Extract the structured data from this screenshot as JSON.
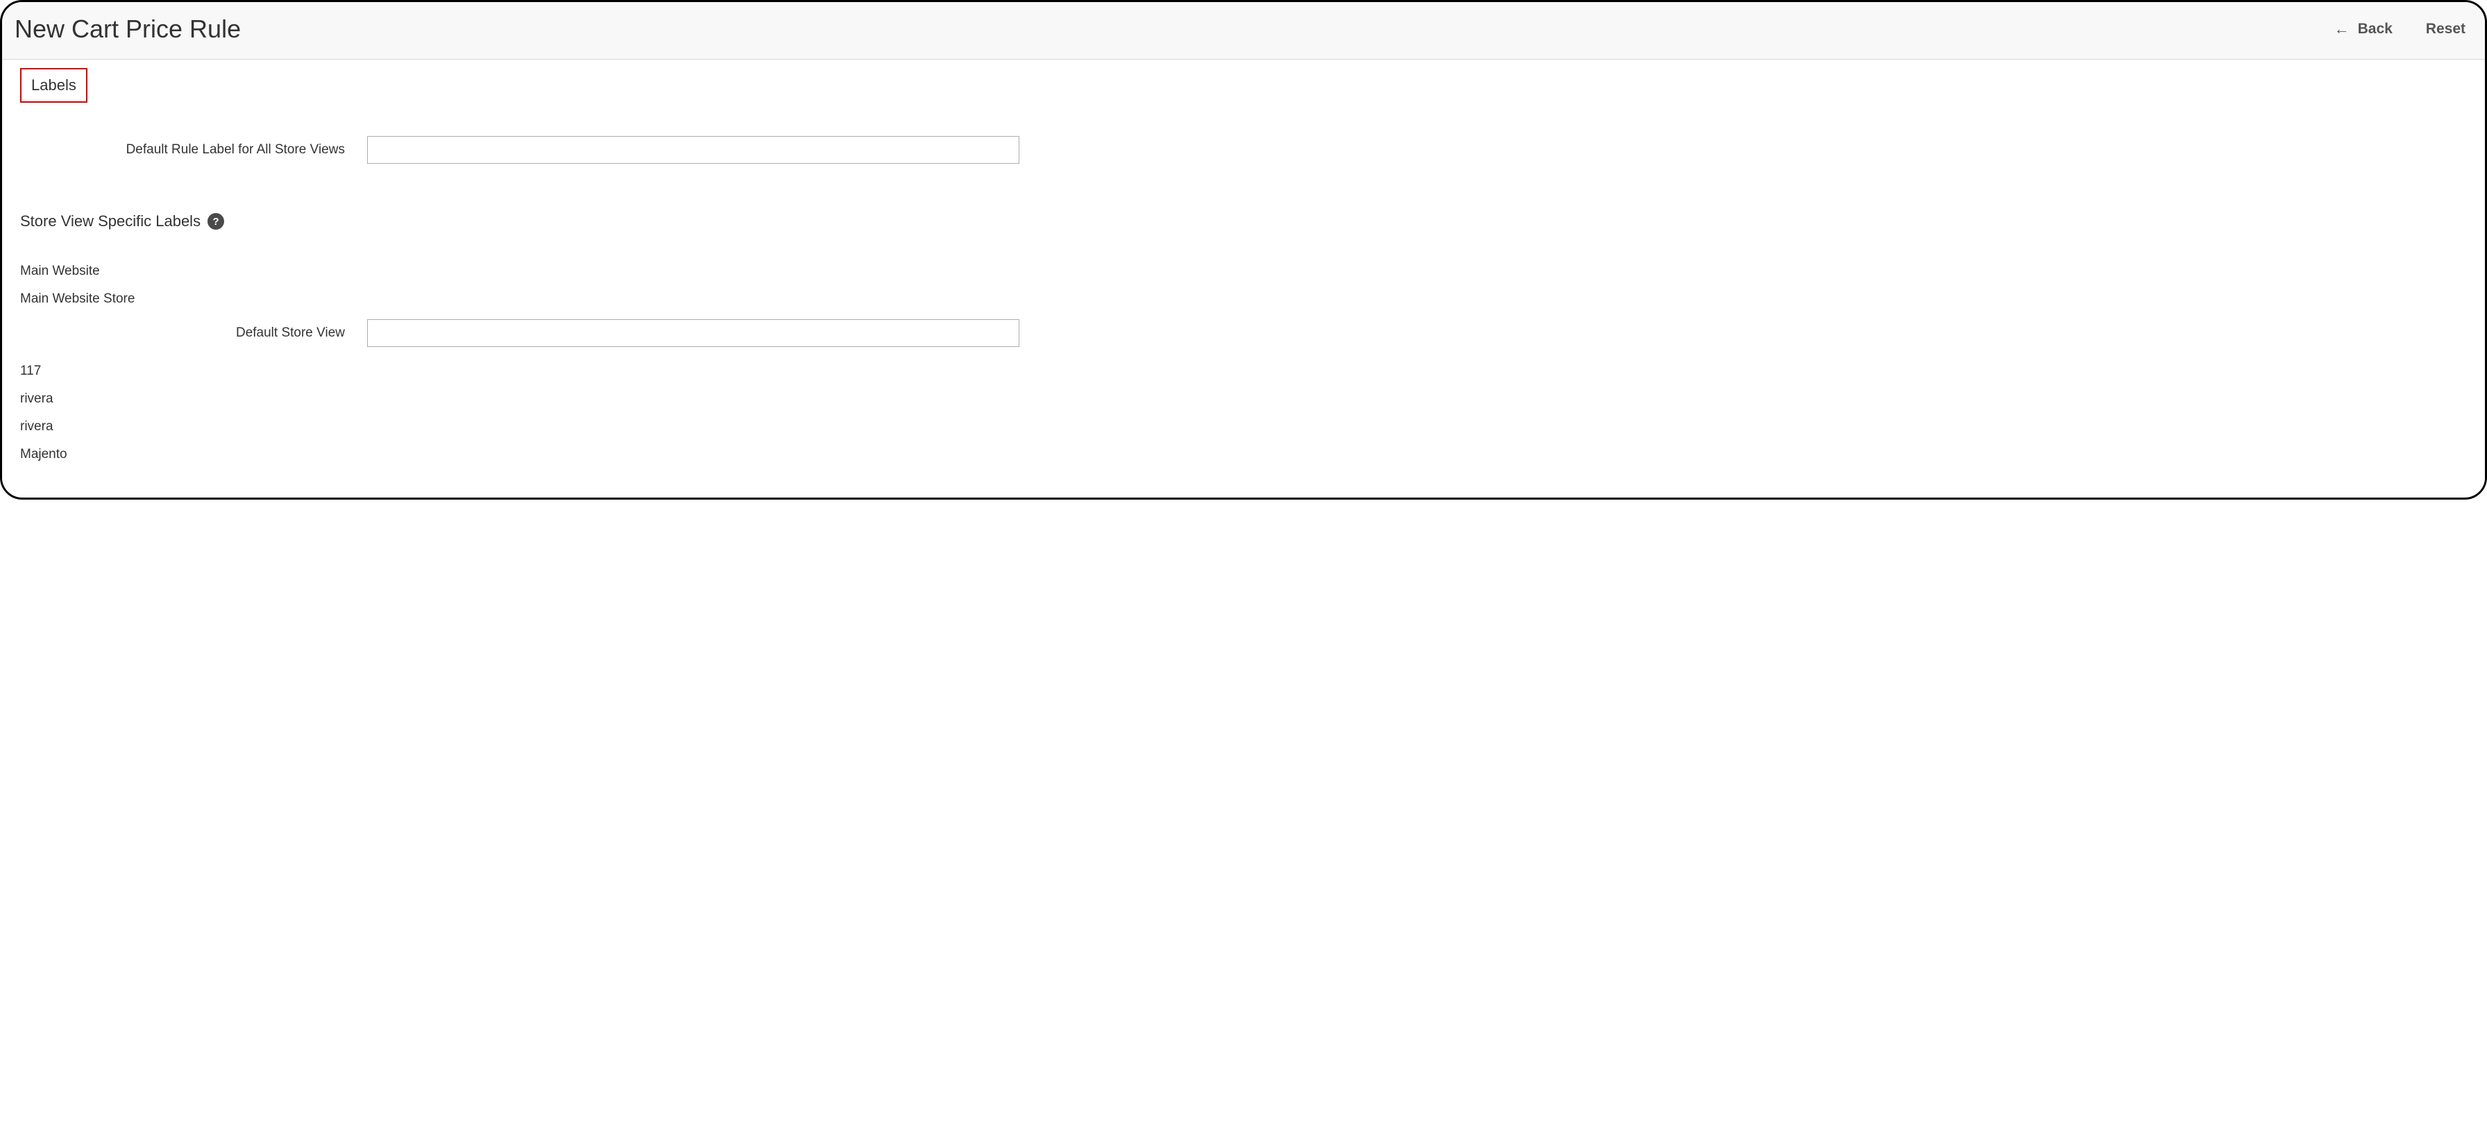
{
  "header": {
    "title": "New Cart Price Rule",
    "back_label": "Back",
    "reset_label": "Reset"
  },
  "labels_section": {
    "tab_title": "Labels",
    "default_rule_label_text": "Default Rule Label for All Store Views",
    "default_rule_value": ""
  },
  "store_specific": {
    "heading": "Store View Specific Labels",
    "website": "Main Website",
    "store_group": "Main Website Store",
    "store_view_label": "Default Store View",
    "store_view_value": "",
    "extra_items": [
      "117",
      "rivera",
      "rivera",
      "Majento"
    ]
  }
}
